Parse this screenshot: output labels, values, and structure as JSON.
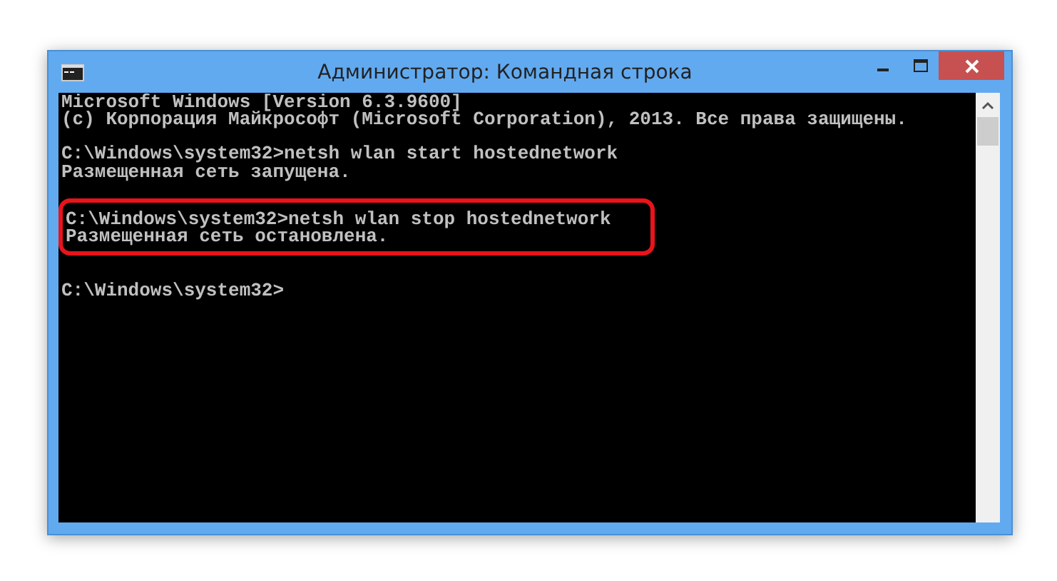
{
  "window": {
    "title": "Администратор: Командная строка"
  },
  "console": {
    "blocks": [
      {
        "highlighted": false,
        "lines": [
          "Microsoft Windows [Version 6.3.9600]",
          "(c) Корпорация Майкрософт (Microsoft Corporation), 2013. Все права защищены."
        ]
      },
      {
        "highlighted": false,
        "lines": [
          "C:\\Windows\\system32>netsh wlan start hostednetwork",
          "Размещенная сеть запущена."
        ]
      },
      {
        "highlighted": true,
        "lines": [
          "C:\\Windows\\system32>netsh wlan stop hostednetwork",
          "Размещенная сеть остановлена."
        ]
      },
      {
        "highlighted": false,
        "lines": [
          "C:\\Windows\\system32>"
        ]
      }
    ]
  }
}
